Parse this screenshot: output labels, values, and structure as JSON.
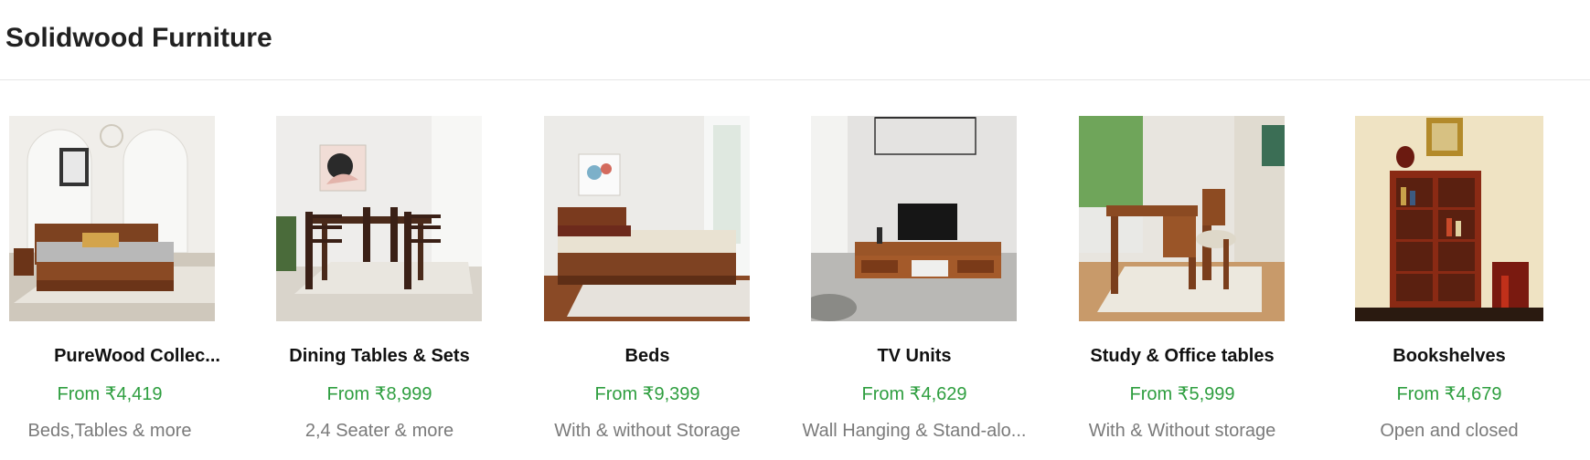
{
  "header": {
    "title": "Solidwood Furniture"
  },
  "cards": [
    {
      "name": "PureWood Collec...",
      "price": "From ₹4,419",
      "subtitle": "Beds,Tables & more",
      "image_icon": "bed-room-image"
    },
    {
      "name": "Dining Tables & Sets",
      "price": "From ₹8,999",
      "subtitle": "2,4 Seater & more",
      "image_icon": "dining-set-image"
    },
    {
      "name": "Beds",
      "price": "From ₹9,399",
      "subtitle": "With & without Storage",
      "image_icon": "bed-image"
    },
    {
      "name": "TV Units",
      "price": "From ₹4,629",
      "subtitle": "Wall Hanging & Stand-alo...",
      "image_icon": "tv-unit-image"
    },
    {
      "name": "Study & Office tables",
      "price": "From ₹5,999",
      "subtitle": "With & Without storage",
      "image_icon": "study-table-image"
    },
    {
      "name": "Bookshelves",
      "price": "From ₹4,679",
      "subtitle": "Open and closed",
      "image_icon": "bookshelf-image"
    }
  ],
  "colors": {
    "price_green": "#2e9e3f",
    "subtitle_gray": "#7a7a7a",
    "wood": "#8a4a24"
  }
}
